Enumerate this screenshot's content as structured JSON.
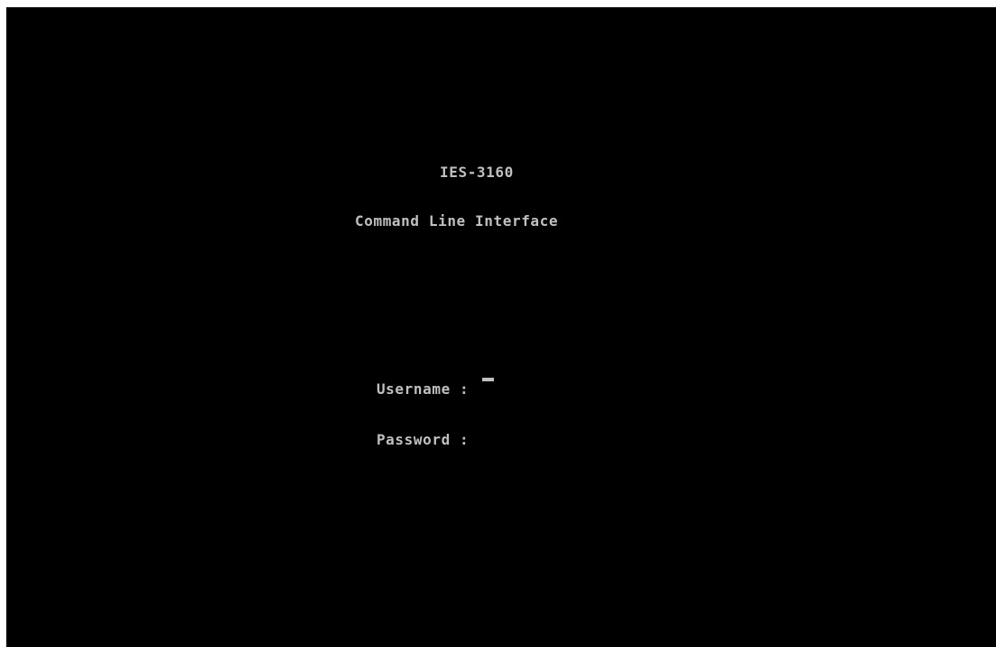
{
  "console": {
    "device_name": "IES-3160",
    "subtitle": "Command Line Interface",
    "username_label": "Username :",
    "password_label": "Password :",
    "username_value": "",
    "password_value": "",
    "text_color": "#c0c0c0",
    "background_color": "#000000"
  }
}
